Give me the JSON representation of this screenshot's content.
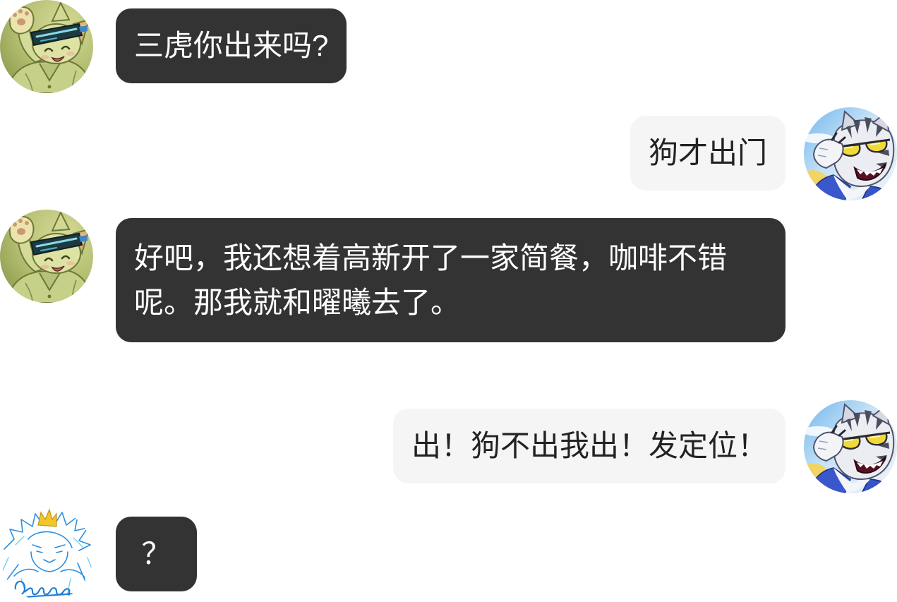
{
  "theme": {
    "background_color": "#ffffff",
    "incoming_bubble_color": "#333333",
    "incoming_text_color": "#ffffff",
    "outgoing_bubble_color": "#f5f5f5",
    "outgoing_text_color": "#222222"
  },
  "messages": [
    {
      "avatar_icon": "green-cat-goggles-avatar",
      "text": "三虎你出来吗?"
    },
    {
      "avatar_icon": "white-tiger-sunglasses-avatar",
      "text": "狗才出门"
    },
    {
      "avatar_icon": "green-cat-goggles-avatar",
      "text": "好吧，我还想着高新开了一家简餐，咖啡不错呢。那我就和曜曦去了。"
    },
    {
      "avatar_icon": "white-tiger-sunglasses-avatar",
      "text": "出！狗不出我出！发定位！"
    },
    {
      "avatar_icon": "blue-sketch-dragon-avatar",
      "text": "？"
    }
  ]
}
